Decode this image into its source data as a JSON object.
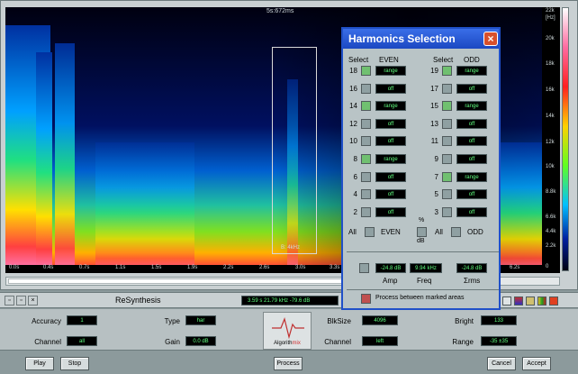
{
  "spectrogram": {
    "time_title": "5s:672ms",
    "time_ticks": [
      "0.0s",
      "0.4s",
      "0.7s",
      "1.1s",
      "1.5s",
      "1.9s",
      "2.2s",
      "2.6s",
      "3.0s",
      "3.3s",
      "6.2s"
    ],
    "freq_unit": "[Hz]",
    "freq_ticks": [
      "22k",
      "20k",
      "18k",
      "16k",
      "14k",
      "12k",
      "10k",
      "8.8k",
      "6.6k",
      "4.4k",
      "2.2k",
      "0"
    ],
    "selection_label": "B: 4kHz"
  },
  "resynthesis": {
    "title": "ReSynthesis",
    "readout": "3.59 s   21.79 kHz   -79.6 dB"
  },
  "params": {
    "accuracy_label": "Accuracy",
    "accuracy_value": "1",
    "channel_label": "Channel",
    "channel_value": "all",
    "type_label": "Type",
    "type_value": "har",
    "gain_label": "Gain",
    "gain_value": "0.0 dB",
    "logo_text_a": "Algorith",
    "logo_text_b": "mix",
    "blksize_label": "BlkSize",
    "blksize_value": "4096",
    "channel2_label": "Channel",
    "channel2_value": "left",
    "bright_label": "Bright",
    "bright_value": "133",
    "range_label": "Range",
    "range_value": "-35 ±35"
  },
  "buttons": {
    "play": "Play",
    "stop": "Stop",
    "process": "Process",
    "cancel": "Cancel",
    "accept": "Accept"
  },
  "dialog": {
    "title": "Harmonics Selection",
    "close": "×",
    "select_even": "Select",
    "even": "EVEN",
    "select_odd": "Select",
    "odd": "ODD",
    "even_rows": [
      {
        "num": "18",
        "on": true,
        "value": "range"
      },
      {
        "num": "16",
        "on": false,
        "value": "off"
      },
      {
        "num": "14",
        "on": true,
        "value": "range"
      },
      {
        "num": "12",
        "on": false,
        "value": "off"
      },
      {
        "num": "10",
        "on": false,
        "value": "off"
      },
      {
        "num": "8",
        "on": true,
        "value": "range"
      },
      {
        "num": "6",
        "on": false,
        "value": "off"
      },
      {
        "num": "4",
        "on": false,
        "value": "off"
      },
      {
        "num": "2",
        "on": false,
        "value": "off"
      }
    ],
    "odd_rows": [
      {
        "num": "19",
        "on": true,
        "value": "range"
      },
      {
        "num": "17",
        "on": false,
        "value": "off"
      },
      {
        "num": "15",
        "on": true,
        "value": "range"
      },
      {
        "num": "13",
        "on": false,
        "value": "off"
      },
      {
        "num": "11",
        "on": false,
        "value": "off"
      },
      {
        "num": "9",
        "on": false,
        "value": "off"
      },
      {
        "num": "7",
        "on": true,
        "value": "range"
      },
      {
        "num": "5",
        "on": false,
        "value": "off"
      },
      {
        "num": "3",
        "on": false,
        "value": "off"
      }
    ],
    "all_label": "All",
    "even_label": "EVEN",
    "odd_label": "ODD",
    "percent_label": "%",
    "db_label": "dB",
    "amp_value": "-24.8 dB",
    "freq_value": "9.94 kHz",
    "rms_value": "-24.8 dB",
    "amp_label": "Amp",
    "freq_label": "Freq",
    "rms_label": "Σrms",
    "process_marked": "Process between marked areas"
  }
}
